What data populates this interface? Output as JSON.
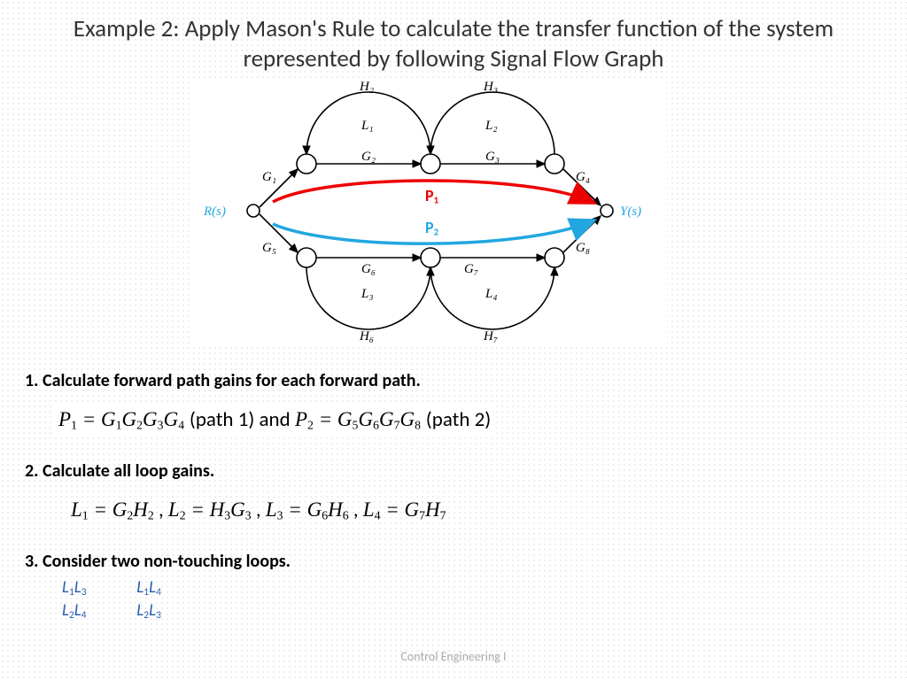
{
  "title": "Example 2: Apply Mason's Rule to calculate the transfer function of the system represented by following Signal Flow Graph",
  "diagram": {
    "input_label": "R(s)",
    "output_label": "Y(s)",
    "upper_gains": [
      "G₁",
      "G₂",
      "G₃",
      "G₄"
    ],
    "lower_gains": [
      "G₅",
      "G₆",
      "G₇",
      "G₈"
    ],
    "upper_feedback": [
      "H₂",
      "H₃"
    ],
    "lower_feedback": [
      "H₆",
      "H₇"
    ],
    "upper_loop_labels": [
      "L₁",
      "L₂"
    ],
    "lower_loop_labels": [
      "L₃",
      "L₄"
    ],
    "path_labels": {
      "p1": "P",
      "p1_sub": "1",
      "p2": "P",
      "p2_sub": "2"
    }
  },
  "steps": {
    "s1": "1. Calculate forward path gains for each forward path.",
    "s1_eq_p1a": "P",
    "s1_eq_p1b": "= G",
    "s1_eq_p1c": "G",
    "s1_eq_p1d": "G",
    "s1_eq_p1e": "G",
    "s1_path1": " (path  1)    and    ",
    "s1_eq_p2a": "P",
    "s1_eq_p2b": "= G",
    "s1_eq_p2c": "G",
    "s1_eq_p2d": "G",
    "s1_eq_p2e": "G",
    "s1_path2": " (path  2)",
    "s2": "2. Calculate all loop gains.",
    "s2_eq": {
      "L1a": "L",
      "L1b": "= G",
      "L1c": "H",
      "comma": " ,     ",
      "L2a": "L",
      "L2b": "= H",
      "L2c": "G",
      "comma2": " ,    ",
      "L3a": "L",
      "L3b": "= G",
      "L3c": "H",
      "comma3": " ,    ",
      "L4a": "L",
      "L4b": "= G",
      "L4c": "H"
    },
    "s3": "3. Consider two non-touching loops.",
    "loops_row1": {
      "a": "L",
      "b": "L",
      "c": "L",
      "d": "L"
    },
    "loops_row2": {
      "a": "L",
      "b": "L",
      "c": "L",
      "d": "L"
    }
  },
  "footer": "Control Engineering I"
}
